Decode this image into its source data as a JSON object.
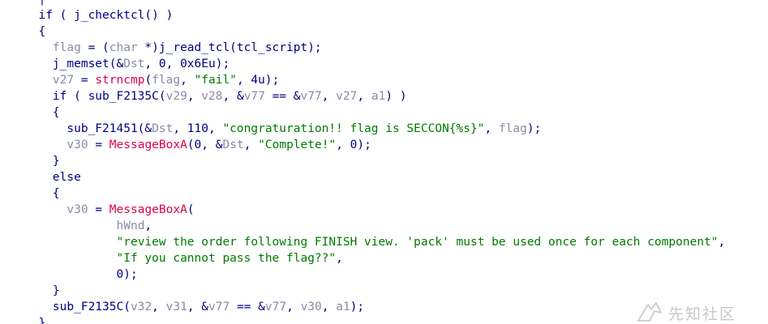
{
  "code_lines": [
    {
      "indent": 0,
      "tokens": [
        {
          "t": "  ",
          "c": "default"
        },
        {
          "t": "┬",
          "c": "default"
        }
      ]
    },
    {
      "indent": 0,
      "tokens": [
        {
          "t": "  if ( j_checktcl() )",
          "c": "default"
        }
      ]
    },
    {
      "indent": 0,
      "tokens": [
        {
          "t": "  {",
          "c": "default"
        }
      ]
    },
    {
      "indent": 0,
      "tokens": [
        {
          "t": "    ",
          "c": "default"
        },
        {
          "t": "flag",
          "c": "var"
        },
        {
          "t": " = (",
          "c": "default"
        },
        {
          "t": "char",
          "c": "type"
        },
        {
          "t": " *)j_read_tcl(tcl_script);",
          "c": "default"
        }
      ]
    },
    {
      "indent": 0,
      "tokens": [
        {
          "t": "    j_memset(&",
          "c": "default"
        },
        {
          "t": "Dst",
          "c": "var"
        },
        {
          "t": ", 0, 0x6Eu);",
          "c": "default"
        }
      ]
    },
    {
      "indent": 0,
      "tokens": [
        {
          "t": "    ",
          "c": "default"
        },
        {
          "t": "v27",
          "c": "var"
        },
        {
          "t": " = ",
          "c": "default"
        },
        {
          "t": "strncmp",
          "c": "func"
        },
        {
          "t": "(",
          "c": "default"
        },
        {
          "t": "flag",
          "c": "var"
        },
        {
          "t": ", ",
          "c": "default"
        },
        {
          "t": "\"fail\"",
          "c": "str"
        },
        {
          "t": ", 4u);",
          "c": "default"
        }
      ]
    },
    {
      "indent": 0,
      "tokens": [
        {
          "t": "    if ( sub_F2135C(",
          "c": "default"
        },
        {
          "t": "v29",
          "c": "var"
        },
        {
          "t": ", ",
          "c": "default"
        },
        {
          "t": "v28",
          "c": "var"
        },
        {
          "t": ", &",
          "c": "default"
        },
        {
          "t": "v77",
          "c": "var"
        },
        {
          "t": " == &",
          "c": "default"
        },
        {
          "t": "v77",
          "c": "var"
        },
        {
          "t": ", ",
          "c": "default"
        },
        {
          "t": "v27",
          "c": "var"
        },
        {
          "t": ", ",
          "c": "default"
        },
        {
          "t": "a1",
          "c": "var"
        },
        {
          "t": ") )",
          "c": "default"
        }
      ]
    },
    {
      "indent": 0,
      "tokens": [
        {
          "t": "    {",
          "c": "default"
        }
      ]
    },
    {
      "indent": 0,
      "tokens": [
        {
          "t": "      sub_F21451(&",
          "c": "default"
        },
        {
          "t": "Dst",
          "c": "var"
        },
        {
          "t": ", 110, ",
          "c": "default"
        },
        {
          "t": "\"congraturation!! flag is SECCON{%s}\"",
          "c": "str"
        },
        {
          "t": ", ",
          "c": "default"
        },
        {
          "t": "flag",
          "c": "var"
        },
        {
          "t": ");",
          "c": "default"
        }
      ]
    },
    {
      "indent": 0,
      "tokens": [
        {
          "t": "      ",
          "c": "default"
        },
        {
          "t": "v30",
          "c": "var"
        },
        {
          "t": " = ",
          "c": "default"
        },
        {
          "t": "MessageBoxA",
          "c": "func"
        },
        {
          "t": "(0, &",
          "c": "default"
        },
        {
          "t": "Dst",
          "c": "var"
        },
        {
          "t": ", ",
          "c": "default"
        },
        {
          "t": "\"Complete!\"",
          "c": "str"
        },
        {
          "t": ", 0);",
          "c": "default"
        }
      ]
    },
    {
      "indent": 0,
      "tokens": [
        {
          "t": "    }",
          "c": "default"
        }
      ]
    },
    {
      "indent": 0,
      "tokens": [
        {
          "t": "    else",
          "c": "default"
        }
      ]
    },
    {
      "indent": 0,
      "tokens": [
        {
          "t": "    {",
          "c": "default"
        }
      ]
    },
    {
      "indent": 0,
      "tokens": [
        {
          "t": "      ",
          "c": "default"
        },
        {
          "t": "v30",
          "c": "var"
        },
        {
          "t": " = ",
          "c": "default"
        },
        {
          "t": "MessageBoxA",
          "c": "func"
        },
        {
          "t": "(",
          "c": "default"
        }
      ]
    },
    {
      "indent": 0,
      "tokens": [
        {
          "t": "             ",
          "c": "default"
        },
        {
          "t": "hWnd",
          "c": "var"
        },
        {
          "t": ",",
          "c": "default"
        }
      ]
    },
    {
      "indent": 0,
      "tokens": [
        {
          "t": "             ",
          "c": "default"
        },
        {
          "t": "\"review the order following FINISH view. 'pack' must be used once for each component\"",
          "c": "str"
        },
        {
          "t": ",",
          "c": "default"
        }
      ]
    },
    {
      "indent": 0,
      "tokens": [
        {
          "t": "             ",
          "c": "default"
        },
        {
          "t": "\"If you cannot pass the flag??\"",
          "c": "str"
        },
        {
          "t": ",",
          "c": "default"
        }
      ]
    },
    {
      "indent": 0,
      "tokens": [
        {
          "t": "             0);",
          "c": "default"
        }
      ]
    },
    {
      "indent": 0,
      "tokens": [
        {
          "t": "    }",
          "c": "default"
        }
      ]
    },
    {
      "indent": 0,
      "tokens": [
        {
          "t": "    sub_F2135C(",
          "c": "default"
        },
        {
          "t": "v32",
          "c": "var"
        },
        {
          "t": ", ",
          "c": "default"
        },
        {
          "t": "v31",
          "c": "var"
        },
        {
          "t": ", &",
          "c": "default"
        },
        {
          "t": "v77",
          "c": "var"
        },
        {
          "t": " == &",
          "c": "default"
        },
        {
          "t": "v77",
          "c": "var"
        },
        {
          "t": ", ",
          "c": "default"
        },
        {
          "t": "v30",
          "c": "var"
        },
        {
          "t": ", ",
          "c": "default"
        },
        {
          "t": "a1",
          "c": "var"
        },
        {
          "t": ");",
          "c": "default"
        }
      ]
    },
    {
      "indent": 0,
      "tokens": [
        {
          "t": "  }",
          "c": "default"
        }
      ]
    }
  ],
  "colors": {
    "default": "#000080",
    "var": "#8a8aa8",
    "str": "#007a00",
    "func": "#e0004a",
    "type": "#8a8aa8"
  },
  "watermark": {
    "icon": "bird-logo-icon",
    "text": "先知社区"
  }
}
